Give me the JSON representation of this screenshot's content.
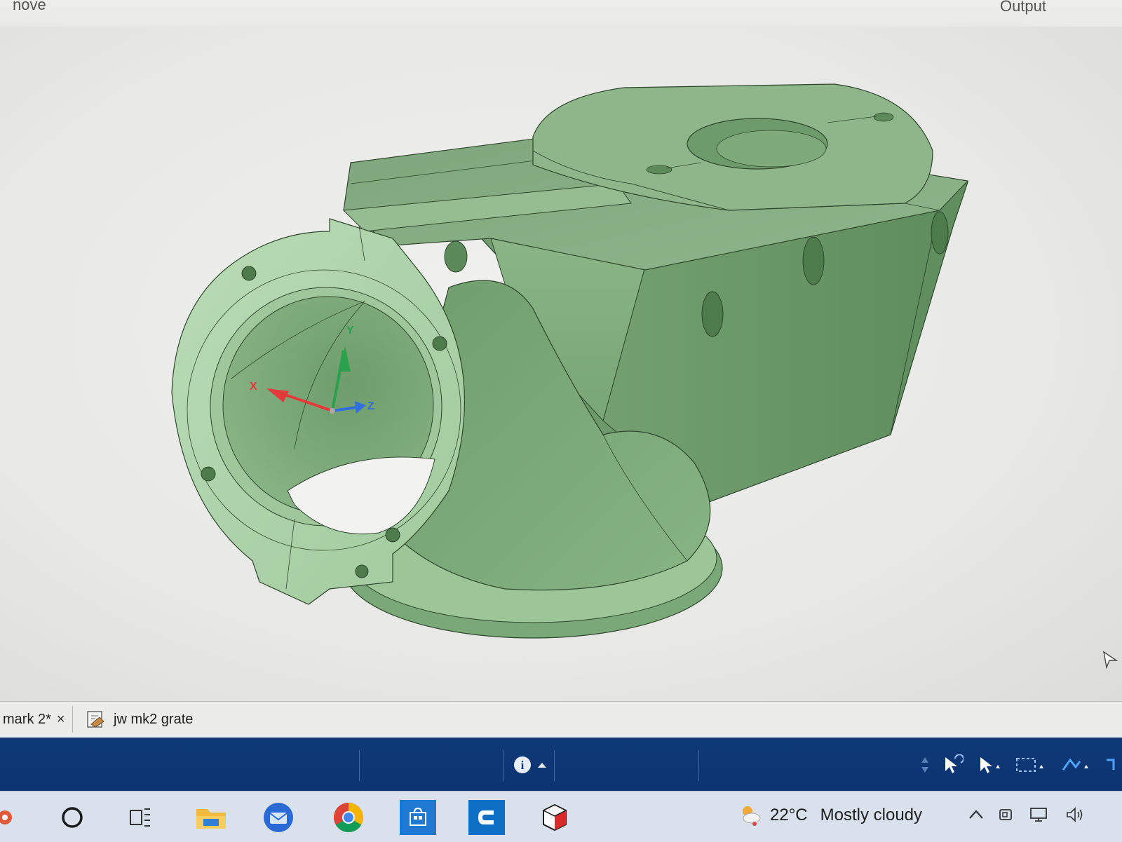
{
  "window": {
    "top_left_label": "nove",
    "top_right_label": "Output"
  },
  "viewport": {
    "triad": {
      "x_label": "X",
      "y_label": "Y",
      "z_label": "Z"
    },
    "model_color": "#8db48a"
  },
  "document_tabs": [
    {
      "label": "mark 2*",
      "close_glyph": "×",
      "icon": "part-document-icon"
    },
    {
      "label": "jw mk2 grate",
      "icon": "part-document-icon"
    }
  ],
  "status_bar": {
    "info_glyph": "i",
    "background": "#0e3a78"
  },
  "taskbar": {
    "icons": [
      "start-icon",
      "search-circle-icon",
      "task-view-icon",
      "file-explorer-icon",
      "thunderbird-icon",
      "chrome-icon",
      "store-icon",
      "cad-app-icon",
      "3d-cube-app-icon"
    ],
    "weather": {
      "temp": "22°C",
      "condition": "Mostly cloudy"
    },
    "tray_icons": [
      "chevron-up-icon",
      "meet-now-icon",
      "network-icon",
      "volume-icon"
    ]
  },
  "colors": {
    "accent": "#0e3a78",
    "model": "#8db48a",
    "axis_x": "#e53a3a",
    "axis_y": "#2aa14a",
    "axis_z": "#2f6fe0"
  }
}
